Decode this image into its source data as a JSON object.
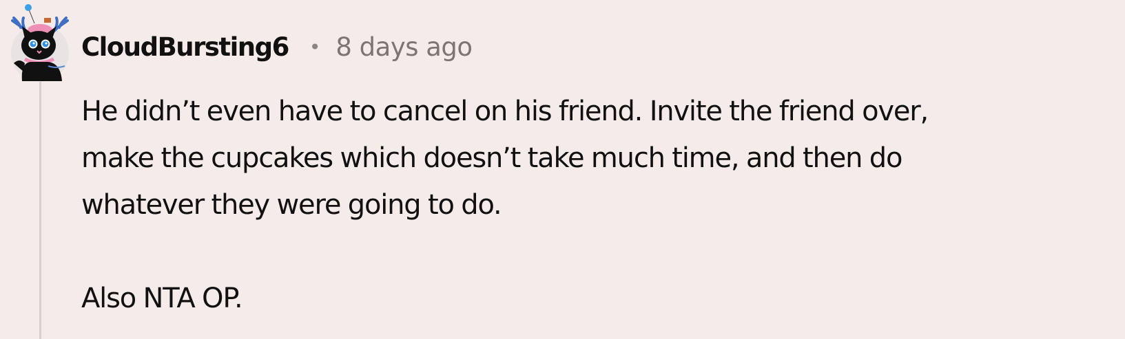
{
  "comment": {
    "author": "CloudBursting6",
    "separator": "•",
    "timestamp": "8 days ago",
    "body_lines": [
      "He didn’t even have to cancel on his friend. Invite the friend over,",
      "make the cupcakes which doesn’t take much time, and then do",
      "whatever they were going to do."
    ],
    "body_second_paragraph": "Also NTA OP."
  },
  "colors": {
    "background": "#f5ebe9",
    "author_text": "#111111",
    "timestamp_text": "#7c7572",
    "thread_line": "#d6d0ce"
  },
  "icons": {
    "avatar": "avatar-black-cat-with-antlers-icon"
  }
}
